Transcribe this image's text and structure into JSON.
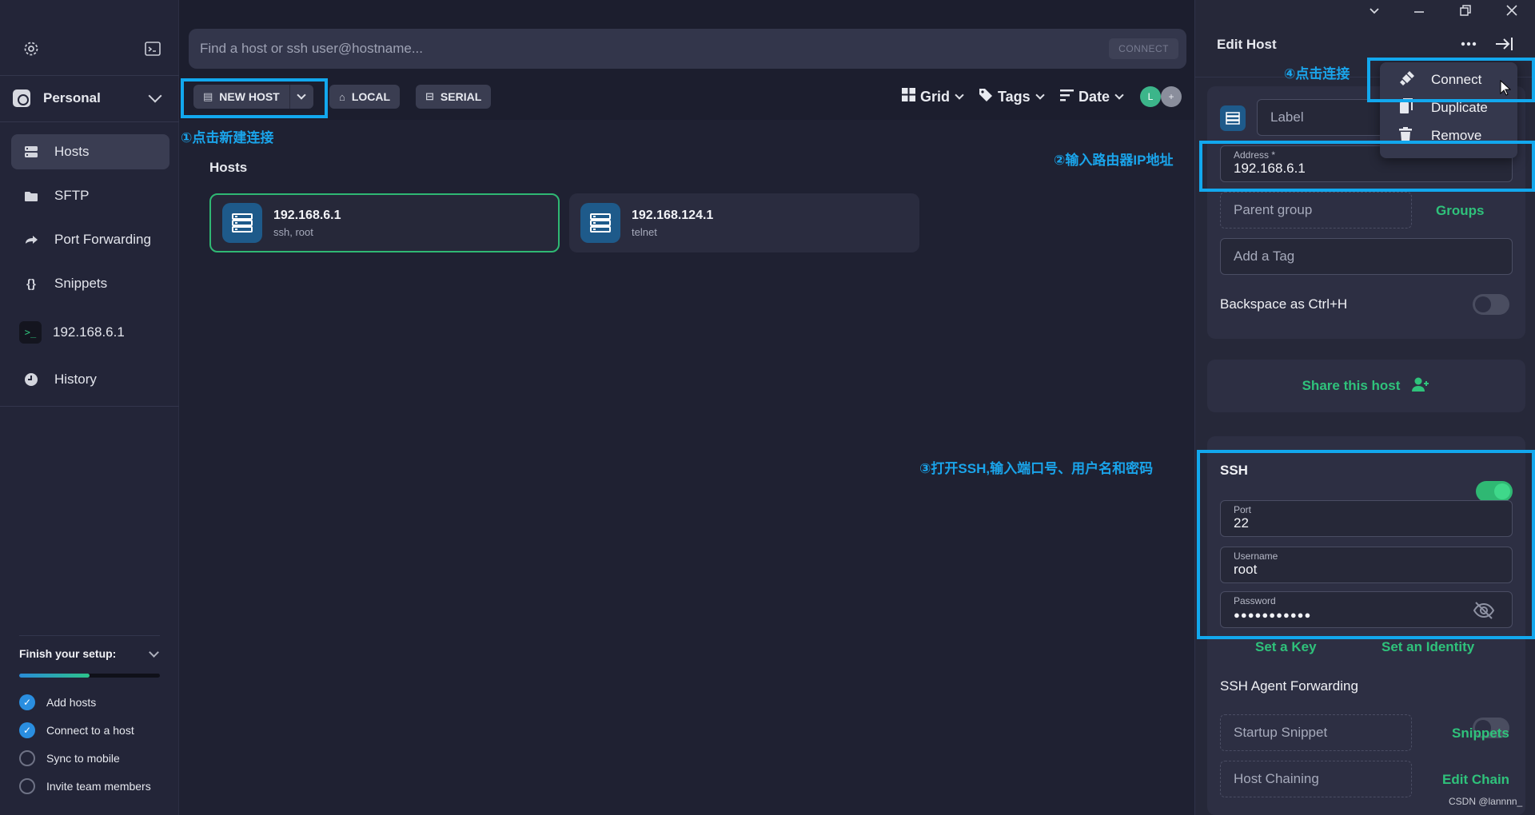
{
  "sidebar": {
    "vault_label": "Personal",
    "nav": [
      {
        "label": "Hosts",
        "icon": "hosts-icon"
      },
      {
        "label": "SFTP",
        "icon": "folder-icon"
      },
      {
        "label": "Port Forwarding",
        "icon": "port-forward-icon"
      },
      {
        "label": "Snippets",
        "icon": "braces-icon"
      },
      {
        "label": "192.168.6.1",
        "icon": "terminal-icon"
      },
      {
        "label": "History",
        "icon": "clock-icon"
      }
    ],
    "terminal_glyph": ">_",
    "braces_glyph": "{}",
    "setup": {
      "title": "Finish your setup:",
      "progress": 0.5,
      "items": [
        {
          "label": "Add hosts",
          "done": true
        },
        {
          "label": "Connect to a host",
          "done": true
        },
        {
          "label": "Sync to mobile",
          "done": false
        },
        {
          "label": "Invite team members",
          "done": false
        }
      ]
    }
  },
  "search": {
    "placeholder": "Find a host or ssh user@hostname...",
    "connect_label": "CONNECT"
  },
  "toolbar": {
    "new_host": "NEW HOST",
    "local": "LOCAL",
    "serial": "SERIAL",
    "grid": "Grid",
    "tags": "Tags",
    "date": "Date",
    "avatar_initial": "L",
    "avatar_add": "+"
  },
  "main": {
    "section_title": "Hosts",
    "hosts": [
      {
        "name": "192.168.6.1",
        "sub": "ssh, root",
        "selected": true
      },
      {
        "name": "192.168.124.1",
        "sub": "telnet",
        "selected": false
      }
    ]
  },
  "annotations": {
    "step1": "①点击新建连接",
    "step2": "②输入路由器IP地址",
    "step3": "③打开SSH,输入端口号、用户名和密码",
    "step4": "④点击连接"
  },
  "panel": {
    "title": "Edit Host",
    "label_placeholder": "Label",
    "address_label": "Address *",
    "address_value": "192.168.6.1",
    "parent_group": "Parent group",
    "groups_link": "Groups",
    "add_tag": "Add a Tag",
    "backspace_label": "Backspace as Ctrl+H",
    "backspace_on": false,
    "share": "Share this host",
    "ssh_label": "SSH",
    "ssh_on": true,
    "port_label": "Port",
    "port_value": "22",
    "username_label": "Username",
    "username_value": "root",
    "password_label": "Password",
    "password_value": "●●●●●●●●●●●",
    "set_key": "Set a Key",
    "set_identity": "Set an Identity",
    "agent_forwarding": "SSH Agent Forwarding",
    "agent_on": false,
    "startup_snippet": "Startup Snippet",
    "snippets_link": "Snippets",
    "host_chaining": "Host Chaining",
    "edit_chain": "Edit Chain",
    "menu": [
      {
        "label": "Connect",
        "icon": "plug-icon"
      },
      {
        "label": "Duplicate",
        "icon": "copy-icon"
      },
      {
        "label": "Remove",
        "icon": "trash-icon"
      }
    ]
  },
  "watermark": "CSDN @lannnn_",
  "colors": {
    "accent_green": "#2fb873",
    "annotation_blue": "#12a8ee",
    "bg": "#1c1e2e"
  }
}
